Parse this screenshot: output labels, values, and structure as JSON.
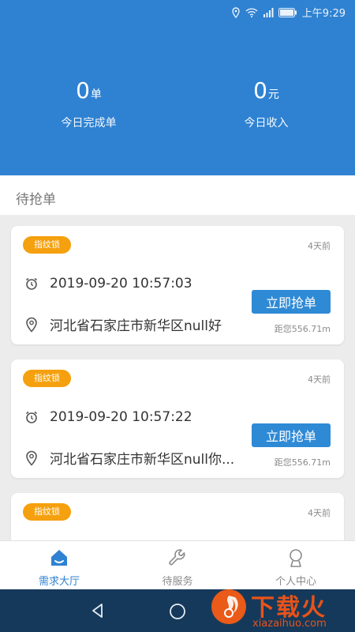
{
  "status_bar": {
    "time": "上午9:29"
  },
  "stats": {
    "completed": {
      "value": "0",
      "unit": "单",
      "label": "今日完成单"
    },
    "income": {
      "value": "0",
      "unit": "元",
      "label": "今日收入"
    }
  },
  "section_title": "待抢单",
  "orders": [
    {
      "tag": "指纹锁",
      "ago": "4天前",
      "time": "2019-09-20 10:57:03",
      "address": "河北省石家庄市新华区null好",
      "button": "立即抢单",
      "distance": "距您556.71m"
    },
    {
      "tag": "指纹锁",
      "ago": "4天前",
      "time": "2019-09-20 10:57:22",
      "address": "河北省石家庄市新华区null你...",
      "button": "立即抢单",
      "distance": "距您556.71m"
    },
    {
      "tag": "指纹锁",
      "ago": "4天前"
    }
  ],
  "tabs": [
    {
      "label": "需求大厅",
      "icon": "home-icon",
      "active": true
    },
    {
      "label": "待服务",
      "icon": "wrench-icon",
      "active": false
    },
    {
      "label": "个人中心",
      "icon": "person-icon",
      "active": false
    }
  ],
  "watermark": {
    "title": "下载火",
    "sub": "xiazaihuo.com"
  },
  "colors": {
    "primary": "#2f82d2",
    "tag": "#f5a00e",
    "nav": "#15395a"
  }
}
